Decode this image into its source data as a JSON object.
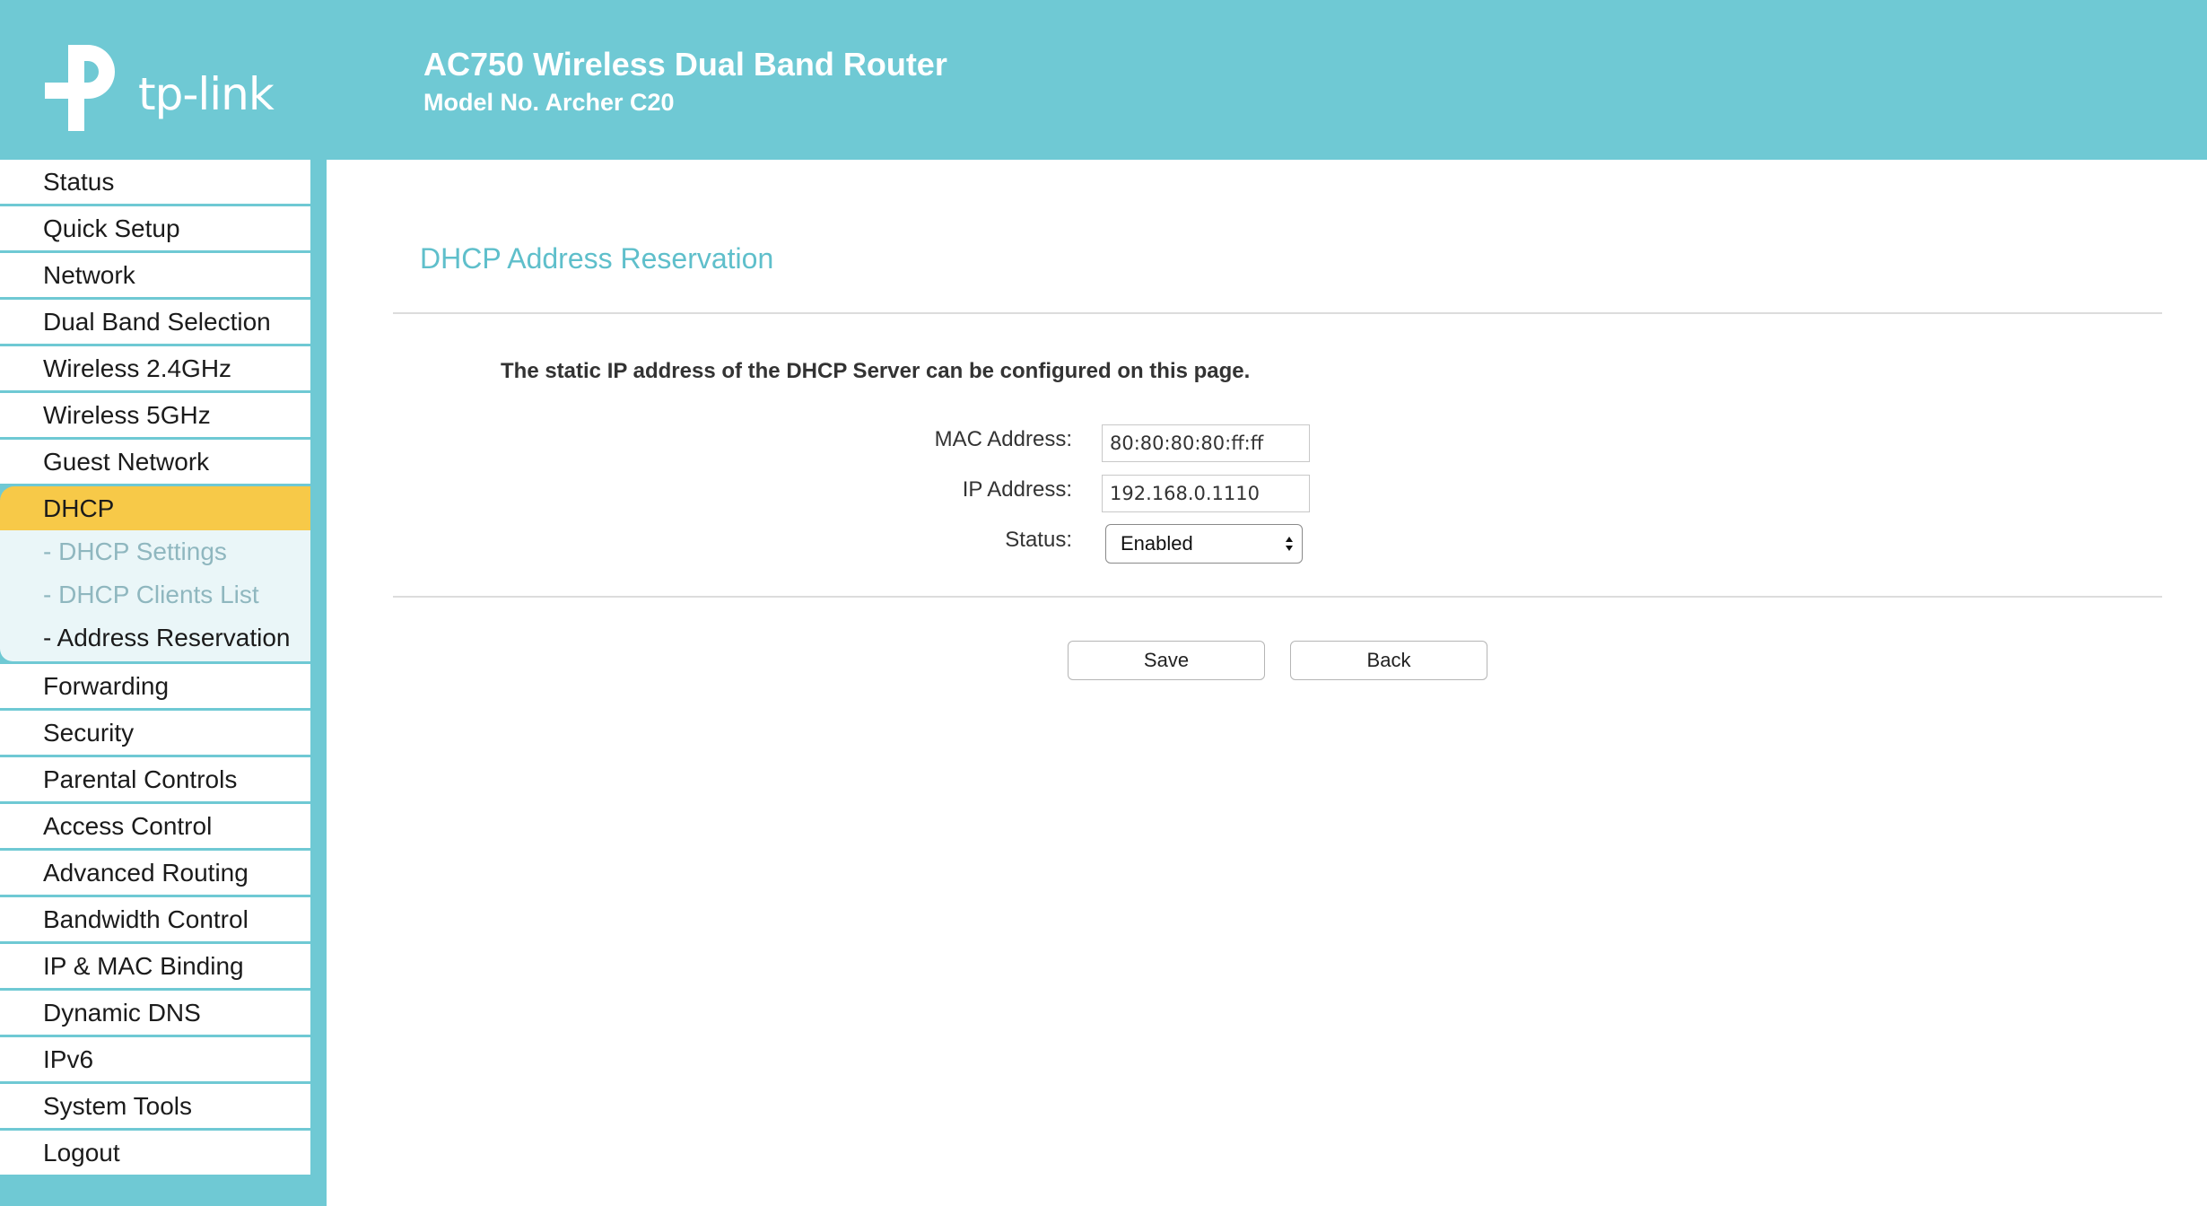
{
  "brand": {
    "logo_text": "tp-link",
    "colors": {
      "header": "#6fc9d4",
      "active_menu": "#f7c948",
      "title": "#5fbfcb"
    }
  },
  "header": {
    "title": "AC750 Wireless Dual Band Router",
    "model": "Model No. Archer C20"
  },
  "sidebar": {
    "items": [
      {
        "label": "Status"
      },
      {
        "label": "Quick Setup"
      },
      {
        "label": "Network"
      },
      {
        "label": "Dual Band Selection"
      },
      {
        "label": "Wireless 2.4GHz"
      },
      {
        "label": "Wireless 5GHz"
      },
      {
        "label": "Guest Network"
      },
      {
        "label": "DHCP"
      },
      {
        "label": "Forwarding"
      },
      {
        "label": "Security"
      },
      {
        "label": "Parental Controls"
      },
      {
        "label": "Access Control"
      },
      {
        "label": "Advanced Routing"
      },
      {
        "label": "Bandwidth Control"
      },
      {
        "label": "IP & MAC Binding"
      },
      {
        "label": "Dynamic DNS"
      },
      {
        "label": "IPv6"
      },
      {
        "label": "System Tools"
      },
      {
        "label": "Logout"
      }
    ],
    "dhcp_sub": [
      {
        "label": "- DHCP Settings"
      },
      {
        "label": "- DHCP Clients List"
      },
      {
        "label": "- Address Reservation"
      }
    ]
  },
  "main": {
    "title": "DHCP Address Reservation",
    "description": "The static IP address of the DHCP Server can be configured on this page.",
    "form": {
      "mac_label": "MAC Address:",
      "mac_value": "80:80:80:80:ff:ff",
      "ip_label": "IP Address:",
      "ip_value": "192.168.0.1110",
      "status_label": "Status:",
      "status_value": "Enabled"
    },
    "buttons": {
      "save": "Save",
      "back": "Back"
    }
  }
}
